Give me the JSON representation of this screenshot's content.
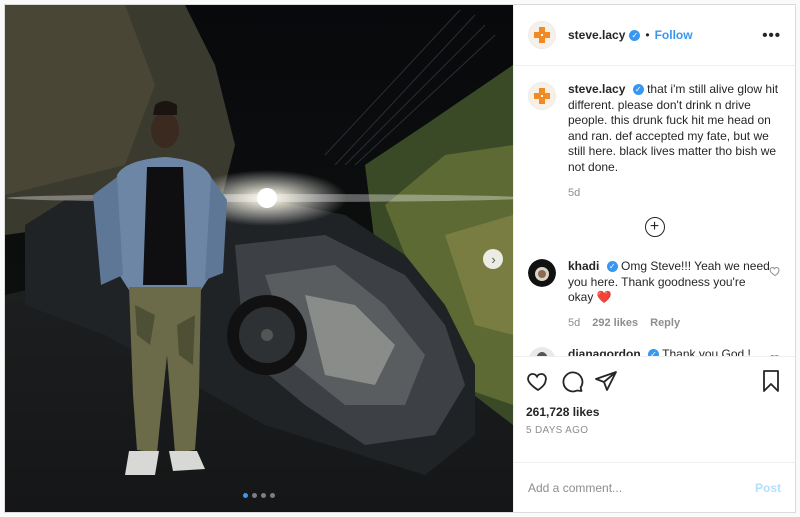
{
  "post": {
    "username": "steve.lacy",
    "follow_label": "Follow",
    "separator": "•",
    "more_label": "•••",
    "caption": "that i'm still alive glow hit different. please don't drink n drive people. this drunk fuck hit me head on and ran. def accepted my fate, but we still here. black lives matter tho bish we not done.",
    "caption_time": "5d",
    "load_more_label": "+",
    "likes": "261,728 likes",
    "date": "5 DAYS AGO",
    "photo_count": 4,
    "active_photo": 1
  },
  "comments": [
    {
      "username": "khadi",
      "text": "Omg Steve!!! Yeah we need you here. Thank goodness you're okay",
      "emoji": "❤️",
      "time": "5d",
      "likes": "292 likes",
      "reply_label": "Reply"
    },
    {
      "username": "dianagordon",
      "text": "Thank you God ! Thank you angels ! Thank you spirit",
      "emoji": "",
      "time": "",
      "likes": "",
      "reply_label": ""
    }
  ],
  "add_comment": {
    "placeholder": "Add a comment...",
    "post_label": "Post"
  },
  "colors": {
    "accent": "#3897f0",
    "post_disabled": "#b2dffc",
    "muted": "#8e8e8e",
    "heart_emoji": "#e0245e"
  },
  "icons": [
    "verified-icon",
    "more-icon",
    "add-circle-icon",
    "heart-icon",
    "comment-icon",
    "share-icon",
    "bookmark-icon",
    "next-arrow-icon"
  ]
}
